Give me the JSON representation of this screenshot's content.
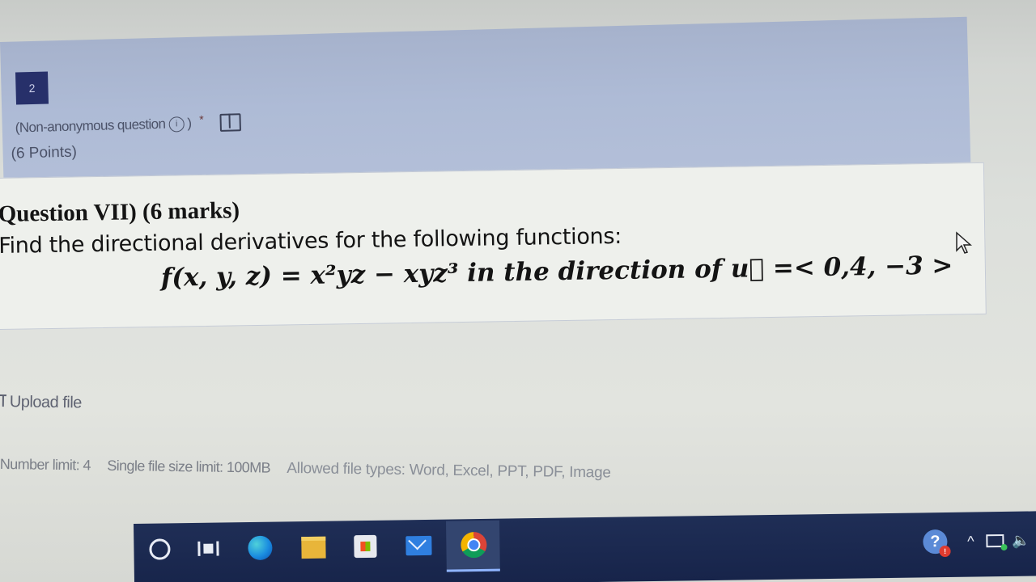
{
  "question": {
    "number": "2",
    "meta": {
      "non_anonymous_label": "(Non-anonymous question",
      "info_glyph": "i",
      "closing_paren": ")",
      "required_mark": "*"
    },
    "points": "(6 Points)",
    "content": {
      "title": "Question VII) (6 marks)",
      "instruction": "Find the directional derivatives for the following functions:",
      "formula": "f(x, y, z) = x²yz − xyz³ in the direction of u⃗ =< 0,4, −3 >"
    }
  },
  "upload": {
    "label": "Upload file",
    "limits": {
      "number_limit": "Number limit: 4",
      "file_size_limit": "Single file size limit: 100MB",
      "allowed_types": "Allowed file types: Word, Excel, PPT, PDF, Image"
    }
  },
  "taskbar": {
    "icons": [
      "search-icon",
      "task-view-icon",
      "edge-icon",
      "file-explorer-icon",
      "store-icon",
      "mail-icon",
      "chrome-icon"
    ],
    "tray": {
      "help_badge": "!",
      "chevron": "^",
      "volume_glyph": "🔈"
    }
  },
  "colors": {
    "header_band": "#aebbd6",
    "question_number_bg": "#27306a",
    "taskbar": "#1f2e56"
  }
}
